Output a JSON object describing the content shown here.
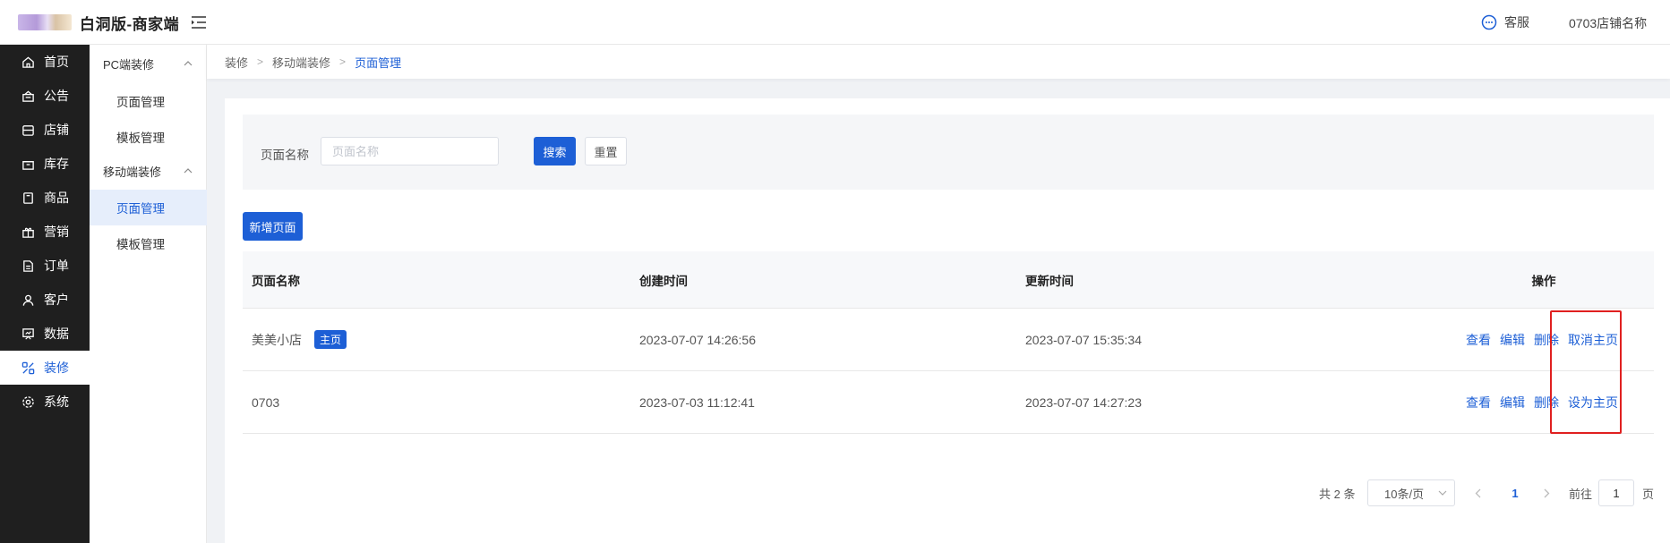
{
  "header": {
    "app_title": "白洞版-商家端",
    "customer_service_label": "客服",
    "store_name": "0703店铺名称"
  },
  "sidebar": {
    "items": [
      {
        "label": "首页",
        "icon": "home-icon"
      },
      {
        "label": "公告",
        "icon": "announcement-icon"
      },
      {
        "label": "店铺",
        "icon": "store-icon"
      },
      {
        "label": "库存",
        "icon": "inventory-icon"
      },
      {
        "label": "商品",
        "icon": "product-icon"
      },
      {
        "label": "营销",
        "icon": "gift-icon"
      },
      {
        "label": "订单",
        "icon": "order-icon"
      },
      {
        "label": "客户",
        "icon": "user-icon"
      },
      {
        "label": "数据",
        "icon": "chart-icon"
      },
      {
        "label": "装修",
        "icon": "decorate-icon",
        "active": true
      },
      {
        "label": "系统",
        "icon": "settings-icon"
      }
    ]
  },
  "subnav": {
    "groups": [
      {
        "label": "PC端装修",
        "items": [
          "页面管理",
          "模板管理"
        ]
      },
      {
        "label": "移动端装修",
        "items": [
          "页面管理",
          "模板管理"
        ]
      }
    ],
    "active_item": "页面管理"
  },
  "breadcrumb": [
    "装修",
    "移动端装修",
    "页面管理"
  ],
  "filter": {
    "label": "页面名称",
    "placeholder": "页面名称",
    "value": "",
    "search_label": "搜索",
    "reset_label": "重置"
  },
  "add_button_label": "新增页面",
  "table": {
    "headers": [
      "页面名称",
      "创建时间",
      "更新时间",
      "操作"
    ],
    "rows": [
      {
        "name": "美美小店",
        "badge": "主页",
        "created": "2023-07-07 14:26:56",
        "updated": "2023-07-07 15:35:34",
        "actions": [
          "查看",
          "编辑",
          "删除",
          "取消主页"
        ]
      },
      {
        "name": "0703",
        "badge": "",
        "created": "2023-07-03 11:12:41",
        "updated": "2023-07-07 14:27:23",
        "actions": [
          "查看",
          "编辑",
          "删除",
          "设为主页"
        ]
      }
    ]
  },
  "pagination": {
    "total_text": "共 2 条",
    "page_size": "10条/页",
    "current_page": "1",
    "goto_label": "前往",
    "goto_value": "1",
    "page_unit": "页"
  },
  "colors": {
    "primary": "#1d5fd6",
    "sidebar_bg": "#1f1f1f",
    "highlight_border": "#e02020"
  }
}
